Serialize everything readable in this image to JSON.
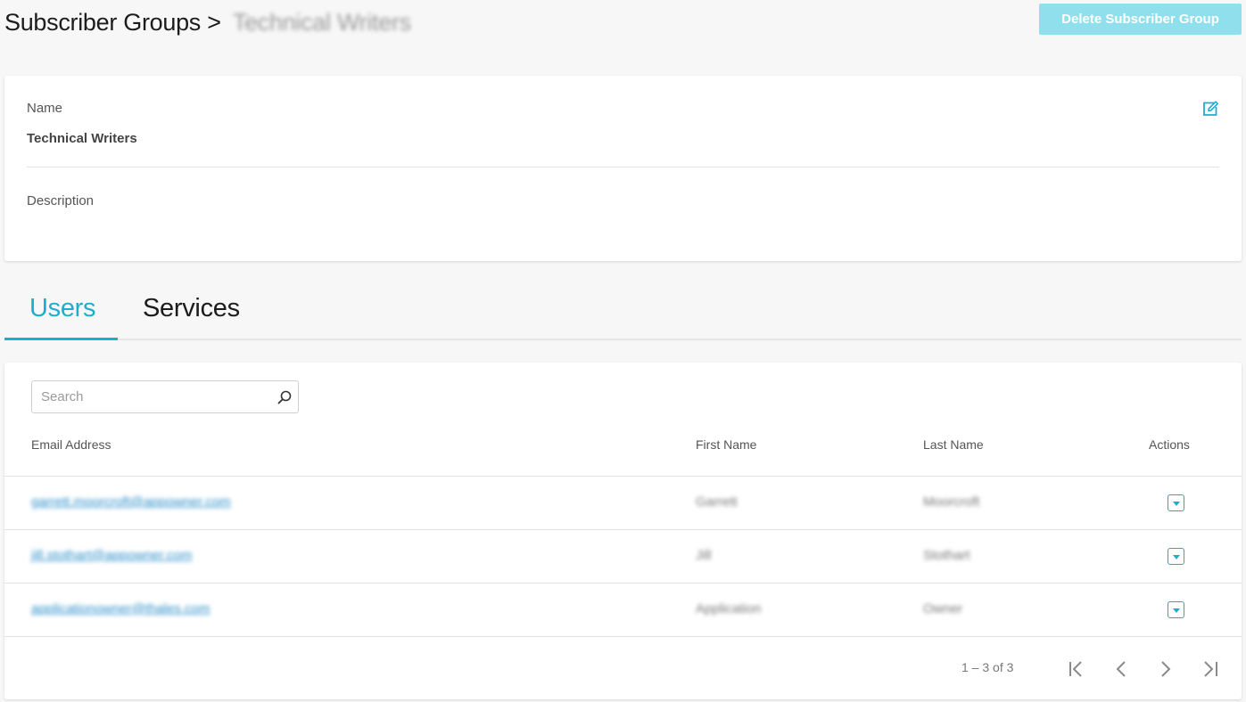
{
  "header": {
    "breadcrumb_root": "Subscriber Groups",
    "breadcrumb_separator": ">",
    "breadcrumb_current": "Technical Writers",
    "delete_label": "Delete Subscriber Group"
  },
  "details": {
    "name_label": "Name",
    "name_value": "Technical Writers",
    "description_label": "Description",
    "description_value": ""
  },
  "tabs": [
    {
      "label": "Users",
      "active": true
    },
    {
      "label": "Services",
      "active": false
    }
  ],
  "search": {
    "placeholder": "Search",
    "value": ""
  },
  "table": {
    "columns": [
      "Email Address",
      "First Name",
      "Last Name",
      "Actions"
    ],
    "rows": [
      {
        "email": "garrett.moorcroft@appowner.com",
        "first": "Garrett",
        "last": "Moorcroft"
      },
      {
        "email": "jill.stothart@appowner.com",
        "first": "Jill",
        "last": "Stothart"
      },
      {
        "email": "applicationowner@thales.com",
        "first": "Application",
        "last": "Owner"
      }
    ]
  },
  "pagination": {
    "range": "1 – 3 of 3"
  },
  "colors": {
    "accent": "#1eaecd",
    "button_disabled": "#8fdfec",
    "link": "#2a8ec9",
    "background": "#f7f7f7"
  },
  "icons": {
    "edit": "edit-icon",
    "search": "search-icon",
    "row_action": "dropdown-icon",
    "first_page": "first-page-icon",
    "prev_page": "chevron-left-icon",
    "next_page": "chevron-right-icon",
    "last_page": "last-page-icon"
  }
}
